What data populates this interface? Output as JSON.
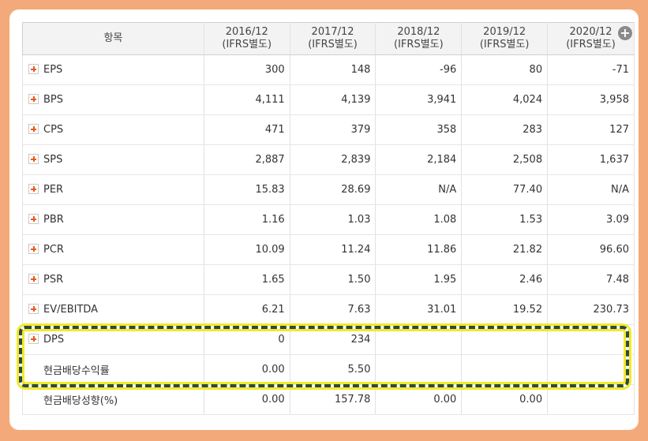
{
  "header": {
    "item_label": "항목",
    "columns": [
      {
        "year": "2016/12",
        "basis": "(IFRS별도)"
      },
      {
        "year": "2017/12",
        "basis": "(IFRS별도)"
      },
      {
        "year": "2018/12",
        "basis": "(IFRS별도)"
      },
      {
        "year": "2019/12",
        "basis": "(IFRS별도)"
      },
      {
        "year": "2020/12",
        "basis": "(IFRS별도)"
      }
    ]
  },
  "rows": [
    {
      "label": "EPS",
      "expandable": true,
      "values": [
        "300",
        "148",
        "-96",
        "80",
        "-71"
      ]
    },
    {
      "label": "BPS",
      "expandable": true,
      "values": [
        "4,111",
        "4,139",
        "3,941",
        "4,024",
        "3,958"
      ]
    },
    {
      "label": "CPS",
      "expandable": true,
      "values": [
        "471",
        "379",
        "358",
        "283",
        "127"
      ]
    },
    {
      "label": "SPS",
      "expandable": true,
      "values": [
        "2,887",
        "2,839",
        "2,184",
        "2,508",
        "1,637"
      ]
    },
    {
      "label": "PER",
      "expandable": true,
      "values": [
        "15.83",
        "28.69",
        "N/A",
        "77.40",
        "N/A"
      ]
    },
    {
      "label": "PBR",
      "expandable": true,
      "values": [
        "1.16",
        "1.03",
        "1.08",
        "1.53",
        "3.09"
      ]
    },
    {
      "label": "PCR",
      "expandable": true,
      "values": [
        "10.09",
        "11.24",
        "11.86",
        "21.82",
        "96.60"
      ]
    },
    {
      "label": "PSR",
      "expandable": true,
      "values": [
        "1.65",
        "1.50",
        "1.95",
        "2.46",
        "7.48"
      ]
    },
    {
      "label": "EV/EBITDA",
      "expandable": true,
      "values": [
        "6.21",
        "7.63",
        "31.01",
        "19.52",
        "230.73"
      ]
    },
    {
      "label": "DPS",
      "expandable": true,
      "values": [
        "0",
        "234",
        "",
        "",
        ""
      ]
    },
    {
      "label": "현금배당수익률",
      "expandable": false,
      "values": [
        "0.00",
        "5.50",
        "",
        "",
        ""
      ]
    },
    {
      "label": "현금배당성향(%)",
      "expandable": false,
      "values": [
        "0.00",
        "157.78",
        "0.00",
        "0.00",
        ""
      ]
    }
  ],
  "colors": {
    "negative": "#e02020",
    "highlight_border": "#2c4a3c",
    "highlight_glow": "#f2ea2a",
    "background": "#f4a97a"
  }
}
